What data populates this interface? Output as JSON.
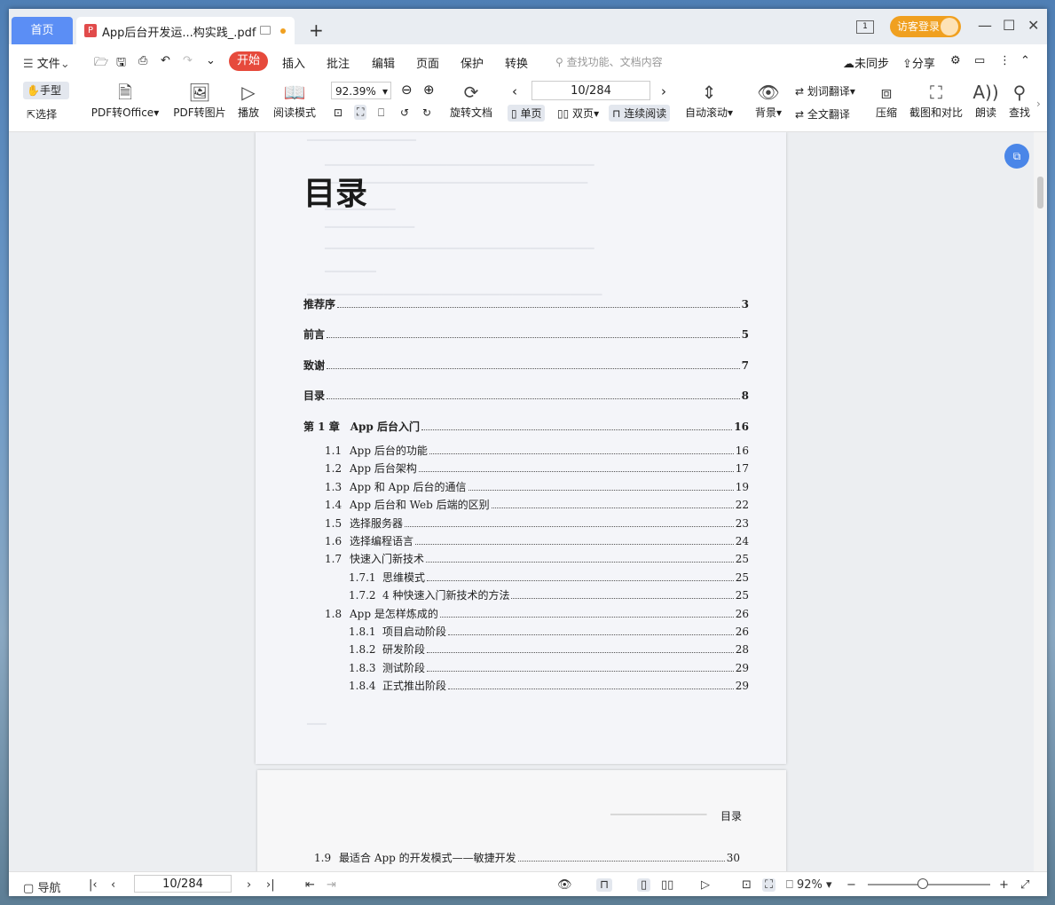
{
  "titlebar": {
    "home_tab": "首页",
    "doc_tab": "App后台开发运...构实践_.pdf",
    "new_tab": "+",
    "page_indicator": "1",
    "login": "访客登录"
  },
  "menubar": {
    "items": [
      "文件",
      "开始",
      "插入",
      "批注",
      "编辑",
      "页面",
      "保护",
      "转换"
    ],
    "search_placeholder": "查找功能、文档内容",
    "sync": "未同步",
    "share": "分享"
  },
  "toolbar": {
    "hand": "手型",
    "select": "选择",
    "pdf_to_office": "PDF转Office",
    "pdf_to_image": "PDF转图片",
    "play": "播放",
    "read_mode": "阅读模式",
    "zoom": "92.39%",
    "rotate": "旋转文档",
    "page_input": "10/284",
    "single": "单页",
    "double": "双页",
    "continuous": "连续阅读",
    "autoscroll": "自动滚动",
    "background": "背景",
    "word_translate": "划词翻译",
    "full_translate": "全文翻译",
    "compress": "压缩",
    "screenshot": "截图和对比",
    "read_aloud": "朗读",
    "find": "查找"
  },
  "document": {
    "heading": "目录",
    "toc_top": [
      {
        "label": "推荐序",
        "page": "3"
      },
      {
        "label": "前言",
        "page": "5"
      },
      {
        "label": "致谢",
        "page": "7"
      },
      {
        "label": "目录",
        "page": "8"
      },
      {
        "label": "第 1 章　App 后台入门",
        "page": "16"
      }
    ],
    "toc_sections": [
      {
        "num": "1.1",
        "label": "App 后台的功能",
        "page": "16",
        "level": 1
      },
      {
        "num": "1.2",
        "label": "App 后台架构",
        "page": "17",
        "level": 1
      },
      {
        "num": "1.3",
        "label": "App 和 App 后台的通信",
        "page": "19",
        "level": 1
      },
      {
        "num": "1.4",
        "label": "App 后台和 Web 后端的区别",
        "page": "22",
        "level": 1
      },
      {
        "num": "1.5",
        "label": "选择服务器",
        "page": "23",
        "level": 1
      },
      {
        "num": "1.6",
        "label": "选择编程语言",
        "page": "24",
        "level": 1
      },
      {
        "num": "1.7",
        "label": "快速入门新技术",
        "page": "25",
        "level": 1
      },
      {
        "num": "1.7.1",
        "label": "思维模式",
        "page": "25",
        "level": 2
      },
      {
        "num": "1.7.2",
        "label": "4 种快速入门新技术的方法",
        "page": "25",
        "level": 2
      },
      {
        "num": "1.8",
        "label": "App 是怎样炼成的",
        "page": "26",
        "level": 1
      },
      {
        "num": "1.8.1",
        "label": "项目启动阶段",
        "page": "26",
        "level": 2
      },
      {
        "num": "1.8.2",
        "label": "研发阶段",
        "page": "28",
        "level": 2
      },
      {
        "num": "1.8.3",
        "label": "测试阶段",
        "page": "29",
        "level": 2
      },
      {
        "num": "1.8.4",
        "label": "正式推出阶段",
        "page": "29",
        "level": 2
      }
    ],
    "page2_header": "目录",
    "page2_row": {
      "num": "1.9",
      "label": "最适合 App 的开发模式——敏捷开发",
      "page": "30"
    }
  },
  "statusbar": {
    "nav": "导航",
    "page_input": "10/284",
    "zoom": "92%"
  }
}
